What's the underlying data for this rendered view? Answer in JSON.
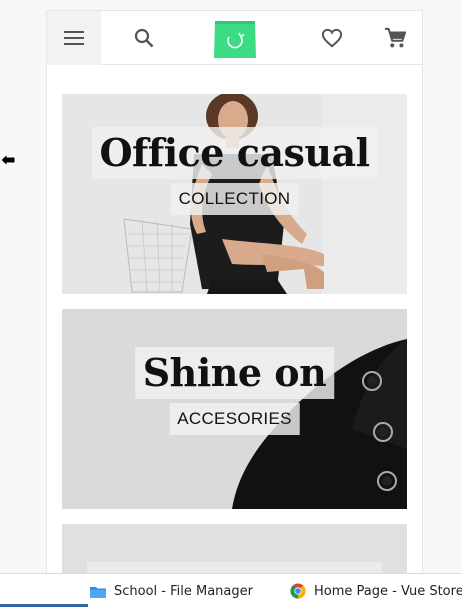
{
  "header": {
    "menu_icon": "hamburger-menu-icon",
    "search_icon": "search-icon",
    "logo_icon": "shopping-bag-logo",
    "wishlist_icon": "heart-icon",
    "cart_icon": "cart-icon",
    "brand_color": "#3ddc84"
  },
  "banners": [
    {
      "title": "Office casual",
      "subtitle": "COLLECTION"
    },
    {
      "title": "Shine on",
      "subtitle": "ACCESORIES"
    },
    {
      "title": "",
      "subtitle": ""
    }
  ],
  "taskbar": {
    "items": [
      {
        "label": "School - File Manager",
        "icon": "folder-icon"
      },
      {
        "label": "Home Page - Vue Store",
        "icon": "chrome-icon"
      }
    ],
    "accent": "#3465a4"
  }
}
